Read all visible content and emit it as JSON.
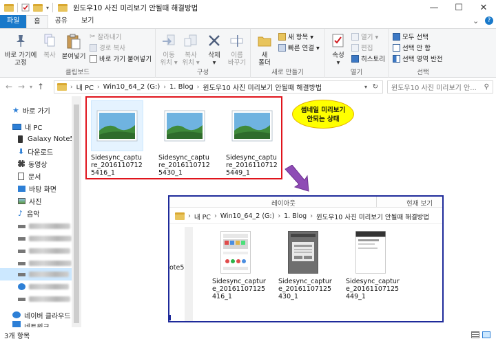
{
  "window": {
    "title": "윈도우10 사진 미리보기 안될때 해결방법",
    "minimize": "—",
    "maximize": "☐",
    "close": "✕",
    "help": "?",
    "ribbon_toggle": "⌄"
  },
  "tabs": [
    "파일",
    "홈",
    "공유",
    "보기"
  ],
  "ribbon": {
    "clipboard": {
      "label": "클립보드",
      "pin": "바로 가기에\n고정",
      "copy": "복사",
      "paste": "붙여넣기",
      "cut": "잘라내기",
      "copy_path": "경로 복사",
      "paste_shortcut": "바로 가기 붙여넣기"
    },
    "organize": {
      "label": "구성",
      "move_to": "이동\n위치 ▾",
      "copy_to": "복사\n위치 ▾",
      "delete": "삭제\n▾",
      "rename": "이름\n바꾸기"
    },
    "new": {
      "label": "새로 만들기",
      "new_folder": "새\n폴더",
      "new_item": "새 항목 ▾",
      "easy_access": "빠른 연결 ▾"
    },
    "open": {
      "label": "열기",
      "properties": "속성\n▾",
      "open": "열기 ▾",
      "edit": "편집",
      "history": "히스토리"
    },
    "select": {
      "label": "선택",
      "select_all": "모두 선택",
      "select_none": "선택 안 함",
      "invert": "선택 영역 반전"
    }
  },
  "address": {
    "crumbs": [
      "내 PC",
      "Win10_64_2 (G:)",
      "1. Blog",
      "윈도우10 사진 미리보기 안될때 해결방법"
    ],
    "search_placeholder": "윈도우10 사진 미리보기 안..."
  },
  "nav": {
    "quick_access": "바로 가기",
    "this_pc": "내 PC",
    "items": [
      "Galaxy Note5",
      "다운로드",
      "동영상",
      "문서",
      "바탕 화면",
      "사진",
      "음악"
    ],
    "network": "네이버 클라우드 (\\",
    "partial": "네트워크"
  },
  "files": [
    {
      "name": "Sidesync_capture_20161107125416_1"
    },
    {
      "name": "Sidesync_capture_20161107125430_1"
    },
    {
      "name": "Sidesync_capture_20161107125449_1"
    }
  ],
  "callout": "썸네일 미리보기\n안되는 상태",
  "inset": {
    "layout_label": "레이아웃",
    "view_label": "현재 보기",
    "crumbs": [
      "내 PC",
      "Win10_64_2 (G:)",
      "1. Blog",
      "윈도우10 사진 미리보기 안될때 해결방법"
    ],
    "side_label": "ote5"
  },
  "status": "3개 항목",
  "colors": {
    "red_box": "#e0141c",
    "blue_box": "#1e2a9a",
    "file_tab": "#1979ca",
    "callout": "#ffff00",
    "arrow": "#8e4bb5"
  }
}
